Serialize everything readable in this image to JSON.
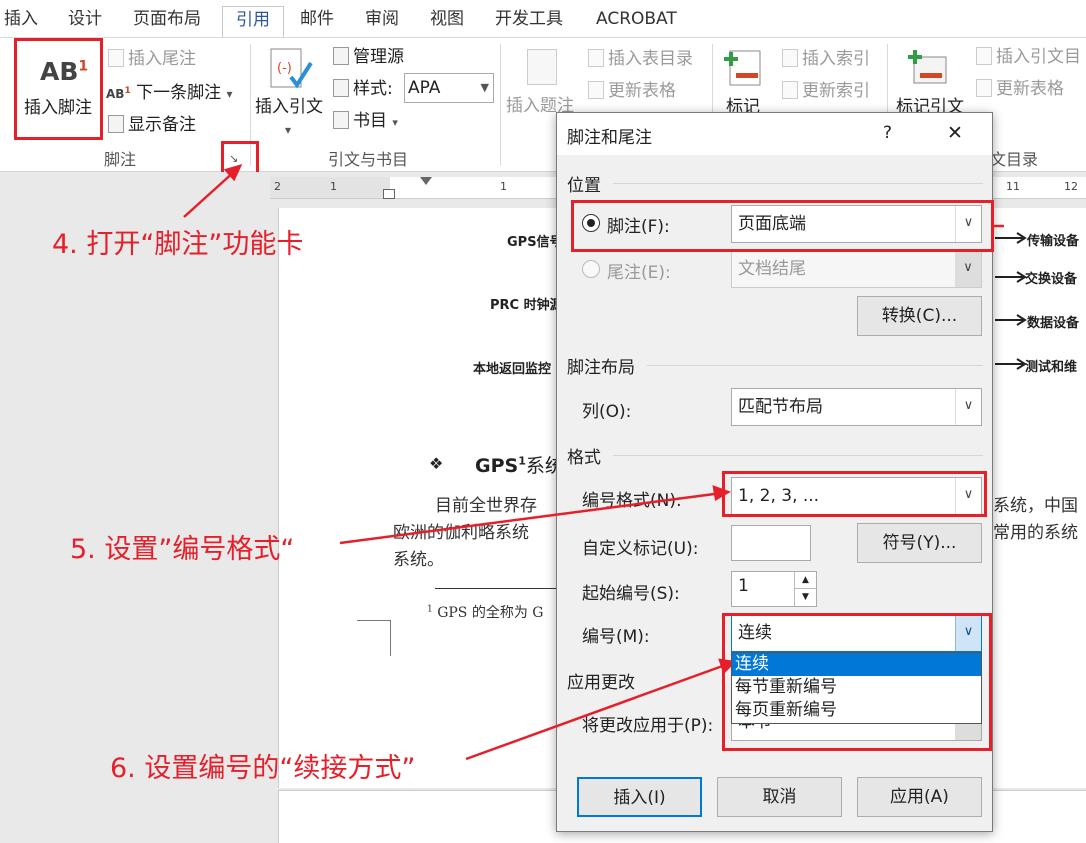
{
  "tabs": [
    "插入",
    "设计",
    "页面布局",
    "引用",
    "邮件",
    "审阅",
    "视图",
    "开发工具",
    "ACROBAT"
  ],
  "ribbon": {
    "footnote_group": {
      "big_icon_text": "AB",
      "big_icon_sup": "1",
      "insert_footnote": "插入脚注",
      "insert_endnote": "插入尾注",
      "next_footnote": "下一条脚注",
      "next_icon_text": "AB",
      "next_icon_sup": "1",
      "next_dropdown": "▾",
      "show_notes": "显示备注",
      "label": "脚注",
      "launcher": "↘"
    },
    "citation_group": {
      "insert_citation": "插入引文",
      "dropdown": "▾",
      "manage_sources": "管理源",
      "style_label": "样式:",
      "style_value": "APA",
      "bibliography": "书目",
      "label": "引文与书目"
    },
    "caption_group": {
      "insert_caption": "插入题注",
      "insert_toc": "插入表目录",
      "update_table": "更新表格"
    },
    "index_group": {
      "mark_entry": "标记",
      "insert_index": "插入索引",
      "update_index": "更新索引"
    },
    "toa_group": {
      "mark_citation": "标记引文",
      "insert_toa": "插入引文目",
      "update_table": "更新表格",
      "label": "文目录"
    }
  },
  "ruler": {
    "ticks": [
      "2",
      "1",
      "1",
      "11",
      "12"
    ]
  },
  "document": {
    "diagram_labels": [
      "GPS信号",
      "PRC 时钟源",
      "本地返回监控"
    ],
    "right_labels": [
      "传输设备",
      "交换设备",
      "数据设备",
      "测试和维"
    ],
    "bullet": "❖",
    "heading": "GPS",
    "heading_sup": "1",
    "heading_tail": "系统",
    "para_line1_left": "目前全世界存",
    "para_line1_right": "系统，中国",
    "para_line2_left": "欧洲的伽利略系统",
    "para_line2_right": "常用的系统",
    "para_line3": "系统。",
    "footnote_sup": "1",
    "footnote_text": "GPS 的全称为 G"
  },
  "dialog": {
    "title": "脚注和尾注",
    "help": "?",
    "close": "✕",
    "position_section": "位置",
    "footnote_label": "脚注(F):",
    "footnote_value": "页面底端",
    "endnote_label": "尾注(E):",
    "endnote_value": "文档结尾",
    "convert_button": "转换(C)...",
    "layout_section": "脚注布局",
    "columns_label": "列(O):",
    "columns_value": "匹配节布局",
    "format_section": "格式",
    "number_format_label": "编号格式(N):",
    "number_format_value": "1, 2, 3, ...",
    "custom_mark_label": "自定义标记(U):",
    "custom_mark_value": "",
    "symbol_button": "符号(Y)...",
    "start_at_label": "起始编号(S):",
    "start_at_value": "1",
    "numbering_label": "编号(M):",
    "numbering_value": "连续",
    "numbering_options": [
      "连续",
      "每节重新编号",
      "每页重新编号"
    ],
    "apply_section": "应用更改",
    "apply_to_label": "将更改应用于(P):",
    "apply_to_value": "本节",
    "insert_button": "插入(I)",
    "cancel_button": "取消",
    "apply_button": "应用(A)"
  },
  "annotations": {
    "step4": "4. 打开“脚注”功能卡",
    "step5": "5. 设置”编号格式“",
    "step6": "6. 设置编号的“续接方式”"
  },
  "colors": {
    "highlight_red": "#e5202a",
    "ribbon_blue": "#2b579a",
    "selection_blue": "#0078d7"
  }
}
